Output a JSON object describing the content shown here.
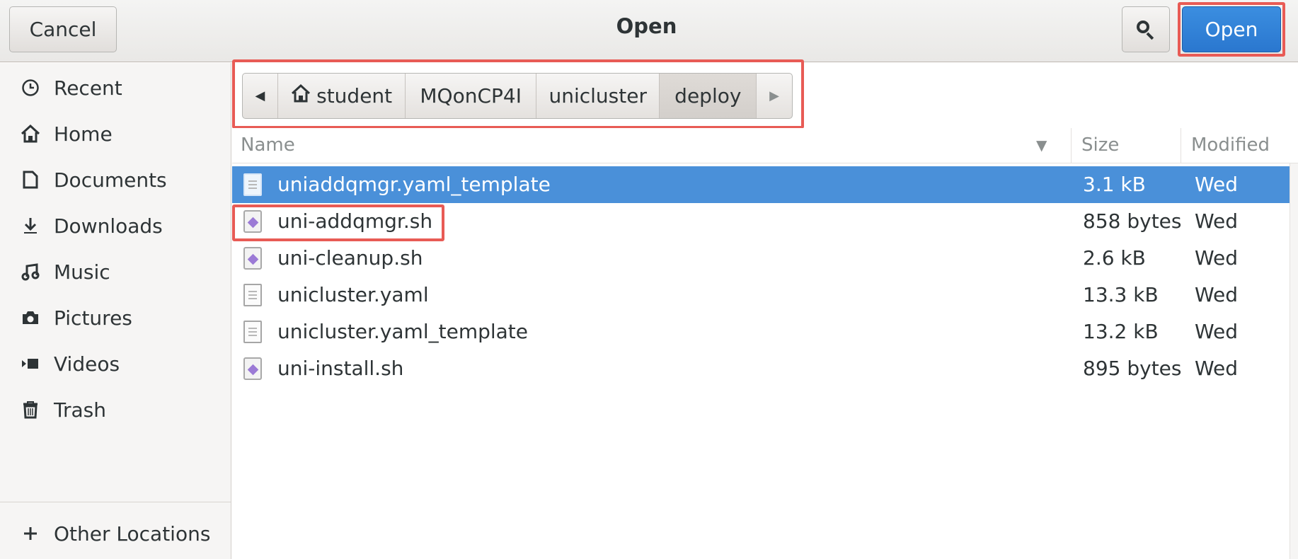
{
  "header": {
    "title": "Open",
    "cancel_label": "Cancel",
    "open_label": "Open",
    "search_icon": "search-icon"
  },
  "sidebar": {
    "items": [
      {
        "label": "Recent",
        "icon": "clock-icon"
      },
      {
        "label": "Home",
        "icon": "home-icon"
      },
      {
        "label": "Documents",
        "icon": "document-icon"
      },
      {
        "label": "Downloads",
        "icon": "download-icon"
      },
      {
        "label": "Music",
        "icon": "music-icon"
      },
      {
        "label": "Pictures",
        "icon": "camera-icon"
      },
      {
        "label": "Videos",
        "icon": "video-icon"
      },
      {
        "label": "Trash",
        "icon": "trash-icon"
      }
    ],
    "other_locations": {
      "label": "Other Locations",
      "icon": "plus-icon"
    }
  },
  "pathbar": {
    "segments": [
      "student",
      "MQonCP4I",
      "unicluster",
      "deploy"
    ],
    "current": "deploy"
  },
  "file_list": {
    "columns": {
      "name": "Name",
      "size": "Size",
      "modified": "Modified"
    },
    "rows": [
      {
        "name": "uniaddqmgr.yaml_template",
        "size": "3.1 kB",
        "modified": "Wed",
        "type": "text",
        "selected": true
      },
      {
        "name": "uni-addqmgr.sh",
        "size": "858 bytes",
        "modified": "Wed",
        "type": "script",
        "highlighted": true
      },
      {
        "name": "uni-cleanup.sh",
        "size": "2.6 kB",
        "modified": "Wed",
        "type": "script"
      },
      {
        "name": "unicluster.yaml",
        "size": "13.3 kB",
        "modified": "Wed",
        "type": "text"
      },
      {
        "name": "unicluster.yaml_template",
        "size": "13.2 kB",
        "modified": "Wed",
        "type": "text"
      },
      {
        "name": "uni-install.sh",
        "size": "895 bytes",
        "modified": "Wed",
        "type": "script"
      }
    ]
  },
  "colors": {
    "accent": "#4a90d9",
    "open_button": "#2f82d9",
    "annotation_highlight": "#e85b55"
  }
}
